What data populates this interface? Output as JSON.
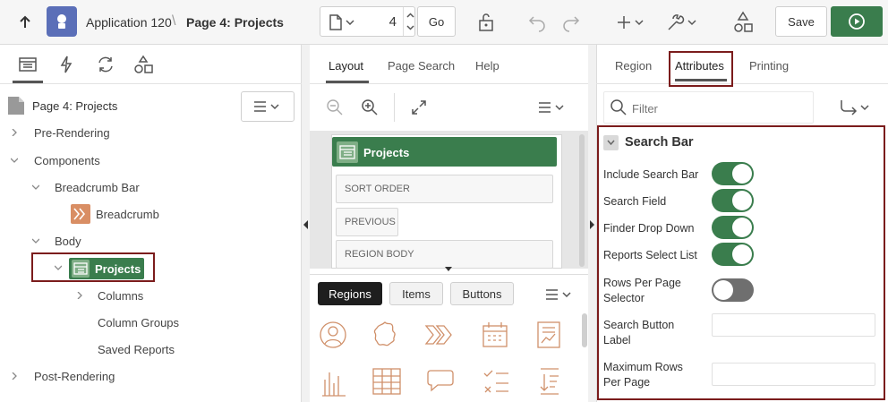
{
  "header": {
    "app_name": "Application 120",
    "separator": "\\",
    "page_name": "Page 4: Projects",
    "page_number": "4",
    "go_label": "Go",
    "save_label": "Save"
  },
  "left_panel": {
    "root_label": "Page 4: Projects",
    "tree": {
      "pre_rendering": "Pre-Rendering",
      "components": "Components",
      "breadcrumb_bar": "Breadcrumb Bar",
      "breadcrumb": "Breadcrumb",
      "body": "Body",
      "projects": "Projects",
      "columns": "Columns",
      "column_groups": "Column Groups",
      "saved_reports": "Saved Reports",
      "post_rendering": "Post-Rendering"
    }
  },
  "middle_panel": {
    "tabs": [
      "Layout",
      "Page Search",
      "Help"
    ],
    "region_title": "Projects",
    "components": [
      "SORT ORDER",
      "PREVIOUS",
      "REGION BODY"
    ],
    "gallery_tabs": [
      "Regions",
      "Items",
      "Buttons"
    ]
  },
  "right_panel": {
    "tabs": [
      "Region",
      "Attributes",
      "Printing"
    ],
    "filter_placeholder": "Filter",
    "section_title": "Search Bar",
    "fields": {
      "include_search_bar": {
        "label": "Include Search Bar",
        "value": "on"
      },
      "search_field": {
        "label": "Search Field",
        "value": "on"
      },
      "finder_drop_down": {
        "label": "Finder Drop Down",
        "value": "on"
      },
      "reports_select_list": {
        "label": "Reports Select List",
        "value": "on"
      },
      "rows_per_page_selector": {
        "label": "Rows Per Page Selector",
        "value": "off"
      },
      "search_button_label": {
        "label": "Search Button Label",
        "value": ""
      },
      "maximum_rows_per_page": {
        "label": "Maximum Rows Per Page",
        "value": ""
      }
    }
  },
  "colors": {
    "accent_green": "#3a7d4d",
    "highlight": "#7b1c1c",
    "app_icon": "#5b6fb8"
  }
}
